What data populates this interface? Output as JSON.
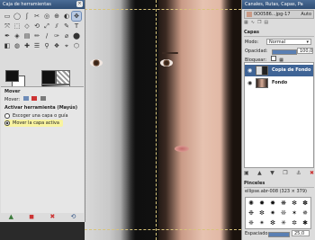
{
  "toolbox": {
    "title": "Caja de herramientas",
    "tools": [
      "▭",
      "◯",
      "ʃ",
      "✂",
      "◎",
      "⊕",
      "◐",
      "✥",
      "⤧",
      "⬚",
      "◇",
      "⟲",
      "⤢",
      "⫽",
      "✎",
      "T",
      "✒",
      "◈",
      "▤",
      "✏",
      "∕",
      "✑",
      "⌀",
      "⬤",
      "◧",
      "◍",
      "✚",
      "☰",
      "⚲",
      "❖",
      "⌖",
      "⬡"
    ],
    "colors": {
      "foreground": "#111111",
      "background": "#ffffff"
    }
  },
  "tool_options": {
    "tool_name": "Mover",
    "move_label": "Mover:",
    "activate_label": "Activar herramienta  (Mayús)",
    "option_pick": "Escoger una capa o guía",
    "option_move_active": "Mover la capa activa"
  },
  "dock": {
    "title": "Canales, Rutas, Capas, Pa",
    "image_tab": "0O0586...jpg-17",
    "auto_label": "Auto",
    "layers_title": "Capas",
    "mode_label": "Modo:",
    "mode_value": "Normal",
    "opacity_label": "Opacidad:",
    "opacity_value": "100,0",
    "lock_label": "Bloquear:",
    "layers": [
      {
        "name": "Copia de Fondo",
        "selected": true
      },
      {
        "name": "Fondo",
        "selected": false
      }
    ],
    "brushes_title": "Pinceles",
    "brush_name": "ellipse.abr-008 (323 × 379)",
    "spacing_label": "Espaciado:",
    "spacing_value": "25,0"
  }
}
